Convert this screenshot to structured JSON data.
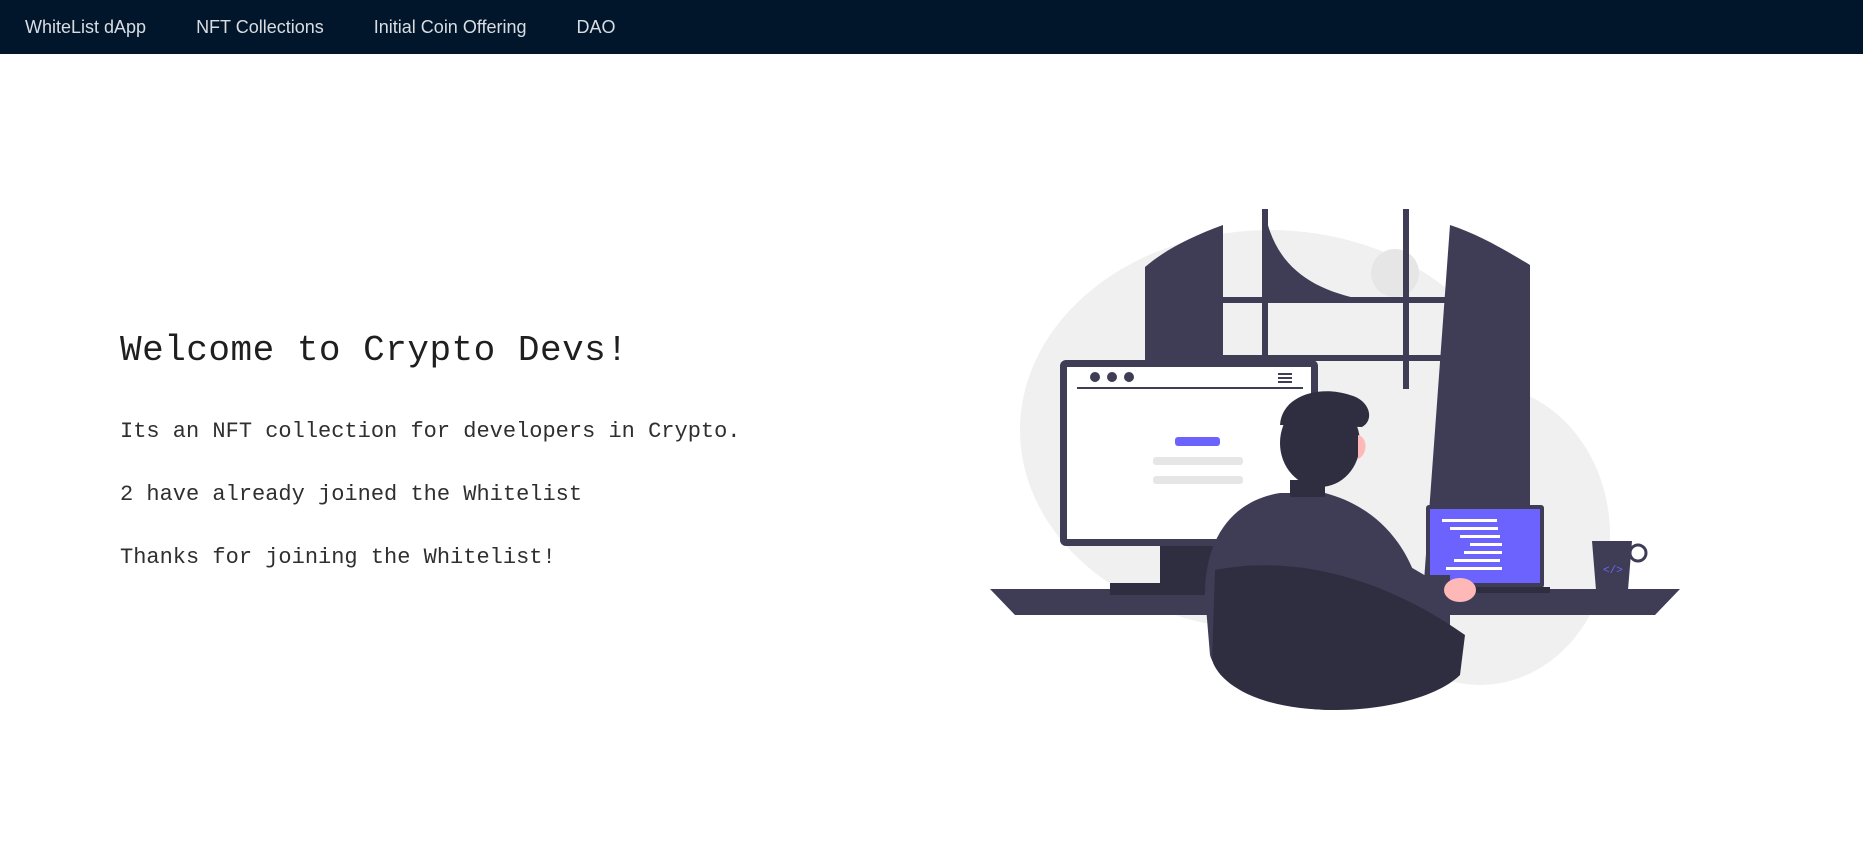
{
  "navbar": {
    "items": [
      {
        "label": "WhiteList dApp"
      },
      {
        "label": "NFT Collections"
      },
      {
        "label": "Initial Coin Offering"
      },
      {
        "label": "DAO"
      }
    ]
  },
  "main": {
    "title": "Welcome to Crypto Devs!",
    "description": "Its an NFT collection for developers in Crypto.",
    "joined_count_text": "2 have already joined the Whitelist",
    "status_message": "Thanks for joining the Whitelist!"
  },
  "illustration": {
    "icon": "developer-at-desk-illustration",
    "mug_glyph": "</>"
  },
  "colors": {
    "navbar_bg": "#02162b",
    "nav_text": "#d9dde3",
    "accent": "#6c63ff",
    "dark": "#3f3d56"
  }
}
